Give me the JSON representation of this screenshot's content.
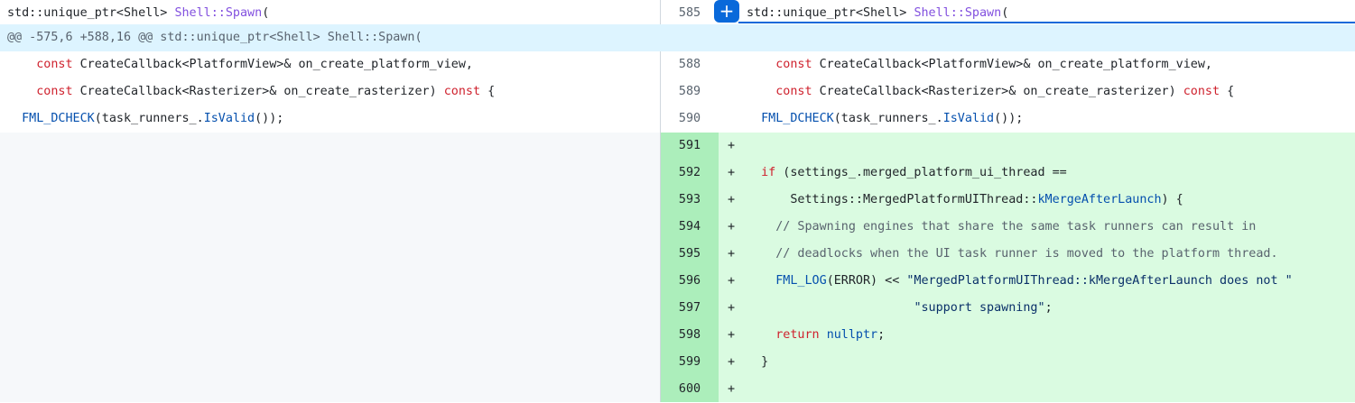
{
  "header": {
    "left_text_prefix": "std::unique_ptr<Shell> ",
    "left_text_fn": "Shell::Spawn",
    "left_text_suffix": "(",
    "right_line_number": "585",
    "right_text_prefix": "std::unique_ptr<Shell> ",
    "right_text_fn": "Shell::Spawn",
    "right_text_suffix": "(",
    "expand_button_label": "+"
  },
  "hunk_header": "@@ -575,6 +588,16 @@ std::unique_ptr<Shell> Shell::Spawn(",
  "context_lines": [
    {
      "line_number": "588",
      "indent": "    ",
      "kw": "const",
      "rest": " CreateCallback<PlatformView>& on_create_platform_view,"
    },
    {
      "line_number": "589",
      "indent": "    ",
      "kw": "const",
      "middle": " CreateCallback<Rasterizer>& on_create_rasterizer) ",
      "kw2": "const",
      "tail": " {"
    },
    {
      "line_number": "590",
      "indent": "  ",
      "fn": "FML_DCHECK",
      "middle": "(task_runners_.",
      "call": "IsValid",
      "tail": "());"
    }
  ],
  "added_lines": {
    "marker": "+",
    "l591": {
      "line_number": "591"
    },
    "l592": {
      "line_number": "592",
      "indent": "  ",
      "kw": "if",
      "rest": " (settings_.merged_platform_ui_thread =="
    },
    "l593": {
      "line_number": "593",
      "indent": "      ",
      "text": "Settings::MergedPlatformUIThread::",
      "ent": "kMergeAfterLaunch",
      "tail": ") {"
    },
    "l594": {
      "line_number": "594",
      "indent": "    ",
      "comment": "// Spawning engines that share the same task runners can result in"
    },
    "l595": {
      "line_number": "595",
      "indent": "    ",
      "comment": "// deadlocks when the UI task runner is moved to the platform thread."
    },
    "l596": {
      "line_number": "596",
      "indent": "    ",
      "fn": "FML_LOG",
      "middle": "(ERROR) << ",
      "str": "\"MergedPlatformUIThread::kMergeAfterLaunch does not \""
    },
    "l597": {
      "line_number": "597",
      "indent": "                       ",
      "str": "\"support spawning\"",
      "tail": ";"
    },
    "l598": {
      "line_number": "598",
      "indent": "    ",
      "kw": "return",
      "space": " ",
      "ent": "nullptr",
      "tail": ";"
    },
    "l599": {
      "line_number": "599",
      "indent": "  ",
      "text": "}"
    },
    "l600": {
      "line_number": "600"
    }
  },
  "colors": {
    "keyword": "#cf222e",
    "function": "#8250df",
    "entity": "#0550ae",
    "string": "#0a3069",
    "comment": "#59636e",
    "added_bg": "#dafbe1",
    "added_gutter_bg": "#aceebb",
    "hunk_bg": "#ddf4ff",
    "accent": "#0969da"
  }
}
